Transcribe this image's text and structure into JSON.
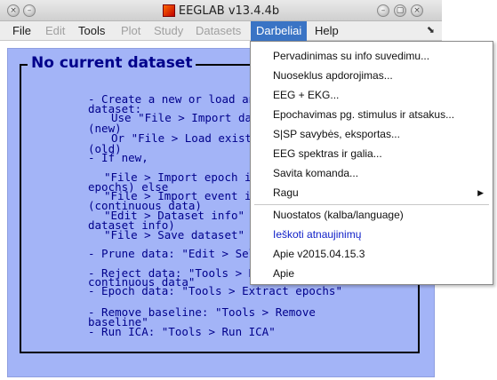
{
  "window": {
    "title": "EEGLAB v13.4.4b",
    "controls": {
      "left1": "×",
      "left2": "–",
      "right1": "–",
      "right2": "▢",
      "right3": "×"
    },
    "resize_glyph": "⬊"
  },
  "menubar": {
    "items": [
      {
        "label": "File",
        "enabled": true
      },
      {
        "label": "Edit",
        "enabled": false
      },
      {
        "label": "Tools",
        "enabled": true
      },
      {
        "label": "Plot",
        "enabled": false
      },
      {
        "label": "Study",
        "enabled": false
      },
      {
        "label": "Datasets",
        "enabled": false
      },
      {
        "label": "Darbeliai",
        "enabled": true,
        "active": true
      },
      {
        "label": "Help",
        "enabled": true
      }
    ]
  },
  "main": {
    "frame_title": "No current dataset",
    "lines": [
      "- Create a new or load an existing dataset:",
      "dataset:",
      "Use \"File > Import data\"",
      "(new)",
      "Or  \"File > Load existing dataset\"",
      "(old)",
      "- If new,",
      "\"File > Import epoch info\" (data",
      "epochs) else",
      "\"File > Import event info\"",
      "(continuous data)",
      "\"Edit > Dataset info\" (add",
      "dataset info)",
      "\"File > Save dataset\" (save",
      "- Prune data: \"Edit > Select data\"",
      "- Reject data: \"Tools > Reject",
      "continuous data\"",
      "- Epoch data: \"Tools > Extract epochs\"",
      "- Remove baseline: \"Tools > Remove",
      "baseline\"",
      "- Run ICA:    \"Tools > Run ICA\""
    ]
  },
  "dropdown": {
    "items": [
      {
        "label": "Pervadinimas su info suvedimu...",
        "type": "normal"
      },
      {
        "label": "Nuoseklus apdorojimas...",
        "type": "normal"
      },
      {
        "label": "EEG + EKG...",
        "type": "normal"
      },
      {
        "label": "Epochavimas pg. stimulus ir atsakus...",
        "type": "normal"
      },
      {
        "label": "S|SP savybės, eksportas...",
        "type": "normal"
      },
      {
        "label": "EEG spektras ir galia...",
        "type": "normal"
      },
      {
        "label": "Savita komanda...",
        "type": "normal"
      },
      {
        "label": "Ragu",
        "type": "submenu",
        "arrow": "▶"
      },
      {
        "label": "Nuostatos (kalba/language)",
        "type": "normal"
      },
      {
        "label": "Ieškoti atnaujinimų",
        "type": "link"
      },
      {
        "label": "Apie v2015.04.15.3",
        "type": "normal"
      },
      {
        "label": "Apie",
        "type": "normal"
      }
    ]
  }
}
